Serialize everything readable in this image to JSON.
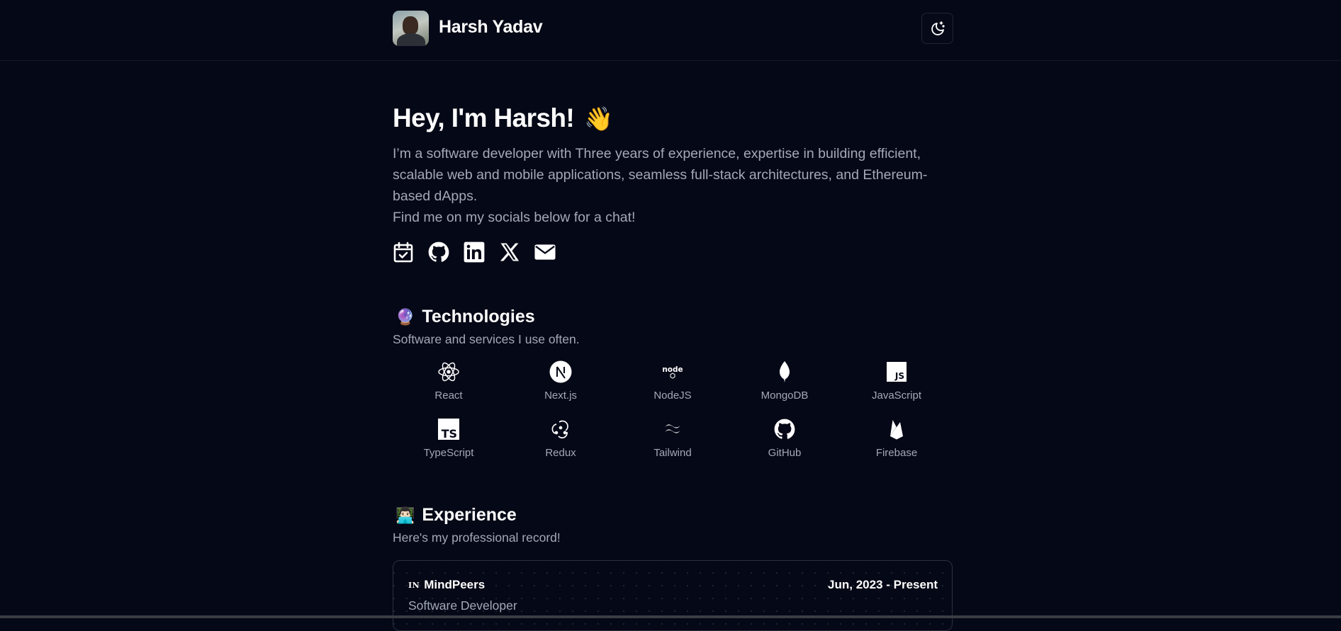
{
  "header": {
    "name": "Harsh Yadav",
    "theme_toggle_icon": "moon-stars-icon"
  },
  "hero": {
    "title": "Hey, I'm Harsh!",
    "wave_emoji": "👋",
    "intro": "I’m a software developer with Three years of experience, expertise in building efficient, scalable web and mobile applications, seamless full-stack architectures, and Ethereum-based dApps.",
    "cta": "Find me on my socials below for a chat!",
    "socials": [
      "calendar-check-icon",
      "github-icon",
      "linkedin-icon",
      "x-icon",
      "mail-icon"
    ]
  },
  "technologies": {
    "emoji": "🔮",
    "title": "Technologies",
    "subtitle": "Software and services I use often.",
    "items": [
      {
        "label": "React",
        "icon": "react-icon"
      },
      {
        "label": "Next.js",
        "icon": "nextjs-icon"
      },
      {
        "label": "NodeJS",
        "icon": "nodejs-icon"
      },
      {
        "label": "MongoDB",
        "icon": "mongodb-icon"
      },
      {
        "label": "JavaScript",
        "icon": "javascript-icon"
      },
      {
        "label": "TypeScript",
        "icon": "typescript-icon"
      },
      {
        "label": "Redux",
        "icon": "redux-icon"
      },
      {
        "label": "Tailwind",
        "icon": "tailwind-icon"
      },
      {
        "label": "GitHub",
        "icon": "github-icon"
      },
      {
        "label": "Firebase",
        "icon": "firebase-icon"
      }
    ]
  },
  "experience": {
    "emoji": "👨🏻‍💻",
    "title": "Experience",
    "subtitle": "Here's my professional record!",
    "items": [
      {
        "logo_text": "IN",
        "company": "MindPeers",
        "date": "Jun, 2023 - Present",
        "role": "Software Developer"
      }
    ]
  },
  "colors": {
    "background": "#050816",
    "text": "#ffffff",
    "muted": "#a3a9b8",
    "border": "#2a3142"
  }
}
